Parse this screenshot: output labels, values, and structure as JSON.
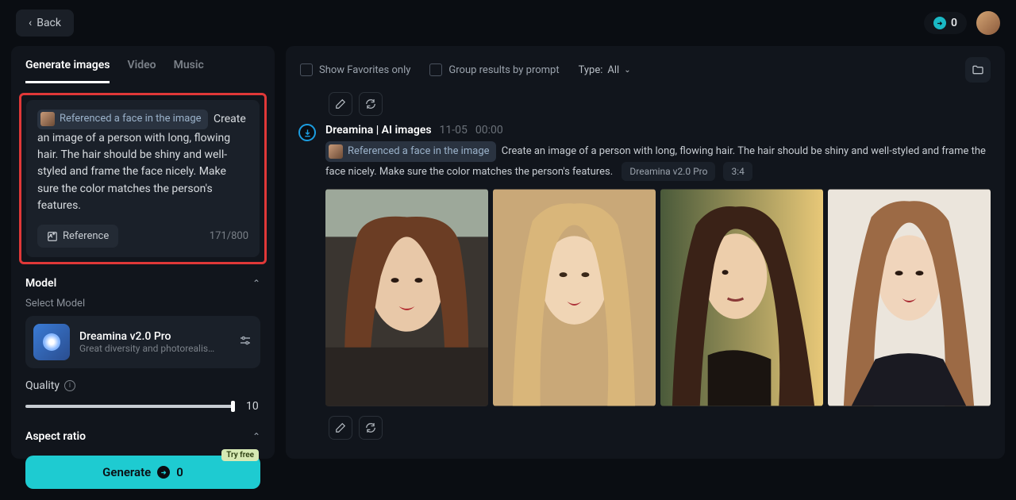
{
  "topbar": {
    "back_label": "Back",
    "credits": "0"
  },
  "sidebar": {
    "tabs": {
      "images": "Generate images",
      "video": "Video",
      "music": "Music"
    },
    "prompt": {
      "ref_label": "Referenced a face in the image",
      "text": "Create an image of a person with long, flowing hair. The hair should be shiny and well-styled and frame the face nicely. Make sure the color matches the person's features.",
      "reference_btn": "Reference",
      "char_count": "171/800"
    },
    "model_section": {
      "title": "Model",
      "select_label": "Select Model",
      "name": "Dreamina v2.0 Pro",
      "desc": "Great diversity and photorealism. Of..."
    },
    "quality": {
      "label": "Quality",
      "value": "10"
    },
    "aspect": {
      "title": "Aspect ratio"
    },
    "generate": {
      "label": "Generate",
      "cost": "0",
      "try_free": "Try free"
    }
  },
  "content": {
    "filters": {
      "favorites": "Show Favorites only",
      "group": "Group results by prompt",
      "type_label": "Type:",
      "type_value": "All"
    },
    "result": {
      "title": "Dreamina | AI images",
      "date": "11-05",
      "time": "00:00",
      "ref_label": "Referenced a face in the image",
      "prompt": "Create an image of a person with long, flowing hair. The hair should be shiny and well-styled and frame the face nicely. Make sure the color matches the person's features.",
      "model": "Dreamina v2.0 Pro",
      "ratio": "3:4"
    }
  }
}
